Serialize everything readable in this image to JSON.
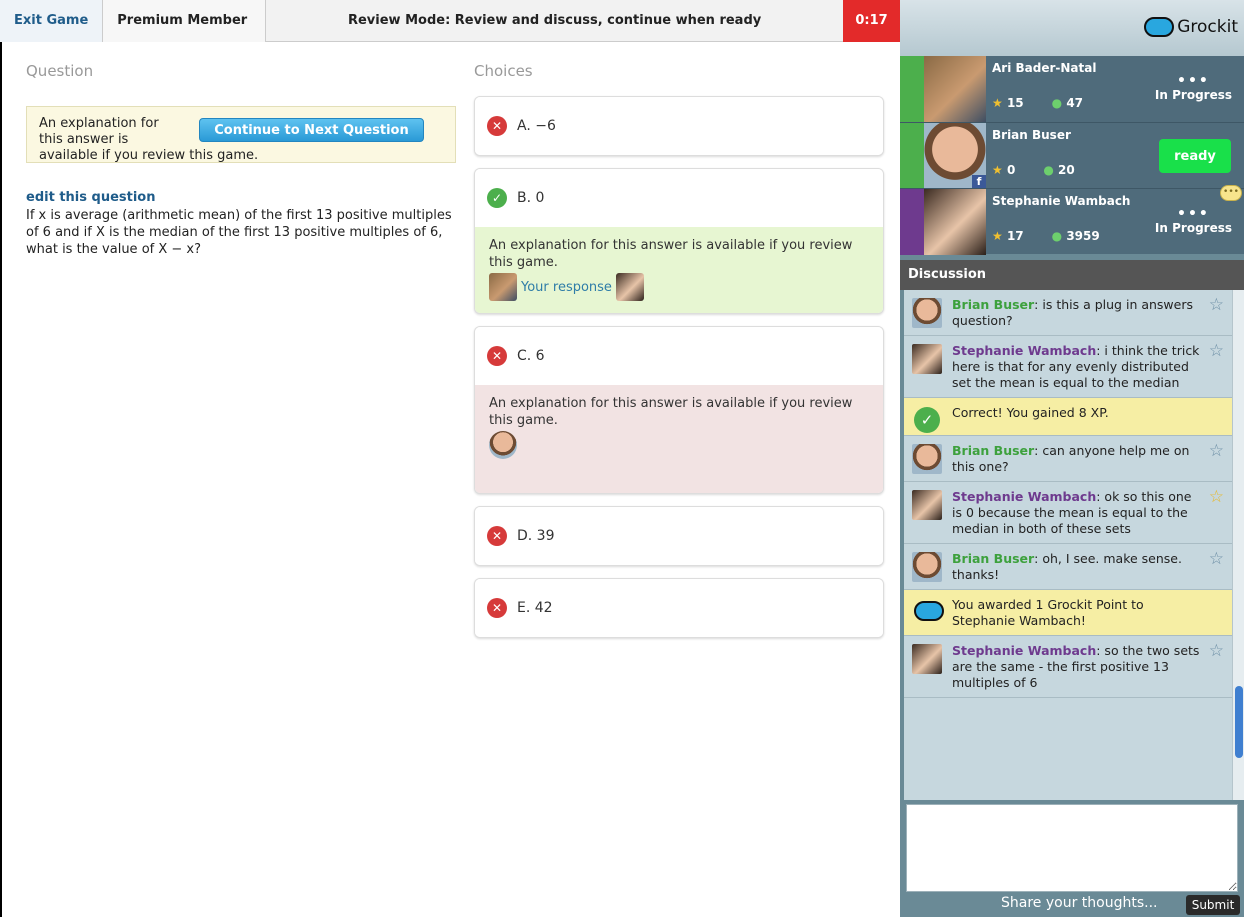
{
  "topbar": {
    "exit_label": "Exit Game",
    "membership": "Premium Member",
    "mode_text": "Review Mode: Review and discuss, continue when ready",
    "timer": "0:17",
    "timer_color": "#e32a2a"
  },
  "question": {
    "heading": "Question",
    "explain_text_1": "An explanation for",
    "explain_text_2": "this answer is",
    "explain_text_3": "available if you review this game.",
    "continue_label": "Continue to Next Question",
    "edit_label": "edit this question",
    "text": "If x is average (arithmetic mean) of the first 13 positive multiples of 6 and if X is the median of the first 13 positive multiples of 6, what is the value of X − x?"
  },
  "choices": {
    "heading": "Choices",
    "items": [
      {
        "label": "A.  −6",
        "status": "wrong"
      },
      {
        "label": "B.  0",
        "status": "correct",
        "explanation": "An explanation for this answer is available if you review this game.",
        "response_label": "Your response"
      },
      {
        "label": "C.  6",
        "status": "wrong",
        "explanation": "An explanation for this answer is available if you review this game."
      },
      {
        "label": "D.  39",
        "status": "wrong"
      },
      {
        "label": "E.  42",
        "status": "wrong"
      }
    ]
  },
  "sidebar": {
    "logo_text": "Grockit",
    "players": [
      {
        "name": "Ari Bader-Natal",
        "stars": "15",
        "points": "47",
        "status": "In Progress",
        "stripe": "#4caf4c"
      },
      {
        "name": "Brian Buser",
        "stars": "0",
        "points": "20",
        "status": "ready",
        "stripe": "#4caf4c"
      },
      {
        "name": "Stephanie Wambach",
        "stars": "17",
        "points": "3959",
        "status": "In Progress",
        "stripe": "#6e3a8e"
      }
    ],
    "discussion_title": "Discussion",
    "messages": [
      {
        "author": "Brian Buser",
        "text": ": is this a plug in answers question?"
      },
      {
        "author": "Stephanie Wambach",
        "text": ": i think the trick here is that for any evenly distributed set the mean is equal to the median"
      },
      {
        "system": "Correct! You gained 8 XP."
      },
      {
        "author": "Brian Buser",
        "text": ": can anyone help me on this one?"
      },
      {
        "author": "Stephanie Wambach",
        "text": ": ok so this one is 0 because the mean is equal to the median in both of these sets"
      },
      {
        "author": "Brian Buser",
        "text": ": oh, I see. make sense. thanks!"
      },
      {
        "system": "You awarded 1 Grockit Point to Stephanie Wambach!"
      },
      {
        "author": "Stephanie Wambach",
        "text": ": so the two sets are the same - the first positive 13 multiples of 6"
      }
    ],
    "share_placeholder": "Share your thoughts...",
    "submit_label": "Submit"
  }
}
